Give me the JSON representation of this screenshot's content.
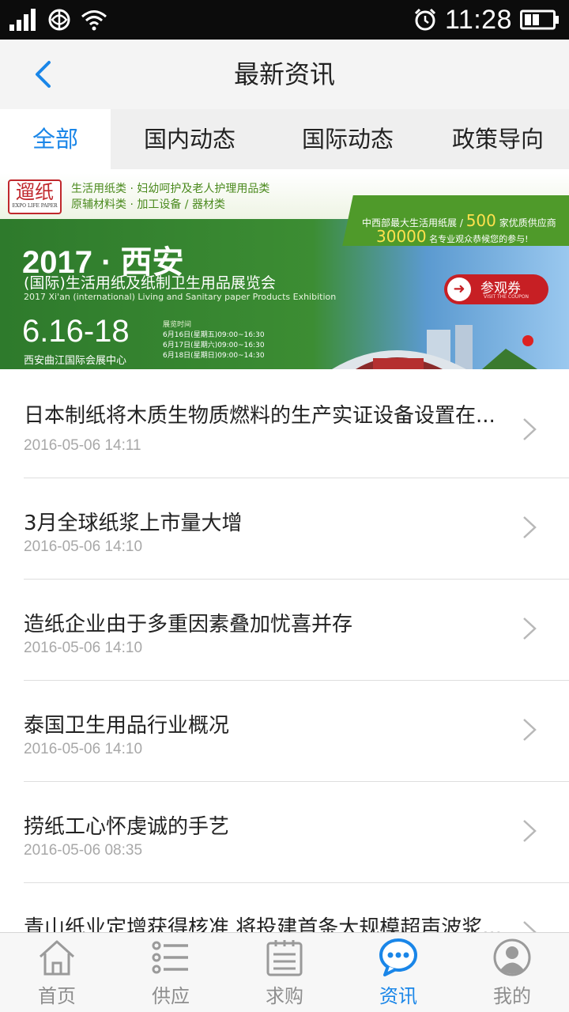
{
  "status_bar": {
    "time": "11:28",
    "icons": [
      "signal-icon",
      "carrier-icon",
      "wifi-icon",
      "alarm-icon",
      "battery-icon"
    ]
  },
  "nav": {
    "title": "最新资讯",
    "back_icon": "chevron-left-icon"
  },
  "tabs": [
    {
      "label": "全部",
      "active": true
    },
    {
      "label": "国内动态",
      "active": false
    },
    {
      "label": "国际动态",
      "active": false
    },
    {
      "label": "政策导向",
      "active": false
    }
  ],
  "banner": {
    "logo_text": "遛纸",
    "logo_sub": "EXPO LIFE PAPER",
    "categories_line1": "生活用纸类 · 妇幼呵护及老人护理用品类",
    "categories_line2": "原辅材料类 · 加工设备 / 器材类",
    "stat_line1_pre": "中西部最大生活用纸展 /",
    "stat_line1_num": "500",
    "stat_line1_post": "家优质供应商",
    "stat_line2_num": "30000",
    "stat_line2_post": "名专业观众恭候您的参与!",
    "year_city": "2017 · 西安",
    "name_cn": "(国际)生活用纸及纸制卫生用品展览会",
    "name_en": "2017 Xi'an (international) Living and Sanitary paper Products Exhibition",
    "date": "6.16-18",
    "venue": "西安曲江国际会展中心",
    "times_header": "展览时间",
    "times": [
      "6月16日(星期五)09:00~16:30",
      "6月17日(星期六)09:00~16:30",
      "6月18日(星期日)09:00~14:30"
    ],
    "coupon_label": "参观券",
    "coupon_sub": "VISIT THE COUPON",
    "colors": {
      "green": "#2e7a2c",
      "red": "#c71f24",
      "yellow": "#ffe14d"
    }
  },
  "news": [
    {
      "title": "日本制纸将木质生物质燃料的生产实证设备设置在...",
      "date": "2016-05-06 14:11"
    },
    {
      "title": "3月全球纸浆上市量大增",
      "date": "2016-05-06 14:10"
    },
    {
      "title": "造纸企业由于多重因素叠加忧喜并存",
      "date": "2016-05-06 14:10"
    },
    {
      "title": "泰国卫生用品行业概况",
      "date": "2016-05-06 14:10"
    },
    {
      "title": "捞纸工心怀虔诚的手艺",
      "date": "2016-05-06 08:35"
    },
    {
      "title": "青山纸业定增获得核准 将投建首条大规模超声波浆...",
      "date": ""
    }
  ],
  "tabbar": [
    {
      "label": "首页",
      "icon": "home-icon",
      "active": false
    },
    {
      "label": "供应",
      "icon": "list-icon",
      "active": false
    },
    {
      "label": "求购",
      "icon": "clipboard-icon",
      "active": false
    },
    {
      "label": "资讯",
      "icon": "chat-bubble-icon",
      "active": true
    },
    {
      "label": "我的",
      "icon": "user-icon",
      "active": false
    }
  ],
  "theme": {
    "accent": "#1a86e8",
    "inactive": "#8e8e8e"
  }
}
